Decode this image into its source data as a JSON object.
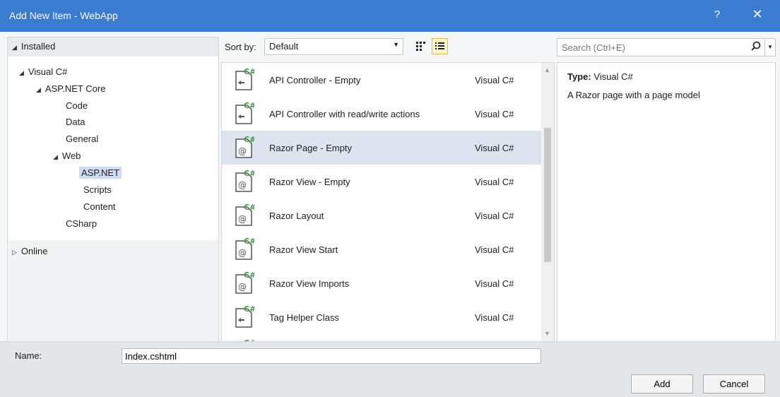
{
  "window": {
    "title": "Add New Item - WebApp",
    "help_label": "?",
    "close_label": "✕"
  },
  "tree": {
    "installed": "Installed",
    "visual_csharp": "Visual C#",
    "aspnet_core": "ASP.NET Core",
    "code": "Code",
    "data": "Data",
    "general": "General",
    "web": "Web",
    "aspnet": "ASP.NET",
    "scripts": "Scripts",
    "content": "Content",
    "csharp": "CSharp",
    "online": "Online"
  },
  "toolbar": {
    "sort_label": "Sort by:",
    "sort_value": "Default"
  },
  "templates": [
    {
      "name": "API Controller - Empty",
      "lang": "Visual C#",
      "icon": "class-icon"
    },
    {
      "name": "API Controller with read/write actions",
      "lang": "Visual C#",
      "icon": "class-icon"
    },
    {
      "name": "Razor Page - Empty",
      "lang": "Visual C#",
      "icon": "razor-icon"
    },
    {
      "name": "Razor View - Empty",
      "lang": "Visual C#",
      "icon": "razor-icon"
    },
    {
      "name": "Razor Layout",
      "lang": "Visual C#",
      "icon": "razor-icon"
    },
    {
      "name": "Razor View Start",
      "lang": "Visual C#",
      "icon": "razor-icon"
    },
    {
      "name": "Razor View Imports",
      "lang": "Visual C#",
      "icon": "razor-icon"
    },
    {
      "name": "Tag Helper Class",
      "lang": "Visual C#",
      "icon": "class-icon"
    }
  ],
  "search": {
    "placeholder": "Search (Ctrl+E)"
  },
  "details": {
    "type_label": "Type:",
    "type_value": "Visual C#",
    "description": "A Razor page with a page model"
  },
  "footer": {
    "name_label": "Name:",
    "name_value": "Index.cshtml",
    "add_label": "Add",
    "cancel_label": "Cancel"
  },
  "colors": {
    "titlebar": "#3c7cd0",
    "selection": "#dde4f0",
    "tree_selection": "#cfdbf0",
    "accent_green": "#3f9e3f"
  }
}
